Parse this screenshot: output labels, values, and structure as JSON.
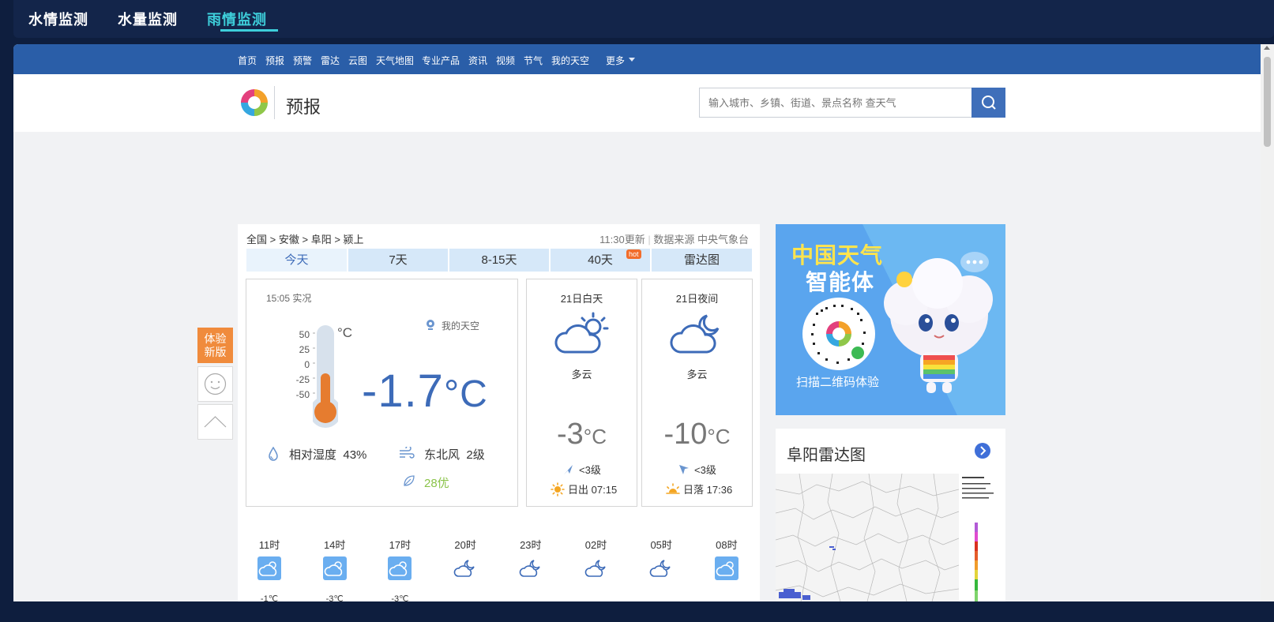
{
  "top_tabs": [
    "水情监测",
    "水量监测",
    "雨情监测"
  ],
  "nav": {
    "items": [
      "首页",
      "预报",
      "预警",
      "雷达",
      "云图",
      "天气地图",
      "专业产品",
      "资讯",
      "视频",
      "节气",
      "我的天空"
    ],
    "more": "更多"
  },
  "header": {
    "title": "预报",
    "search_placeholder": "输入城市、乡镇、街道、景点名称 查天气"
  },
  "breadcrumb": [
    "全国",
    "安徽",
    "阜阳",
    "颍上"
  ],
  "update": {
    "time": "11:30更新",
    "source": "数据来源 中央气象台"
  },
  "forecast_tabs": [
    "今天",
    "7天",
    "8-15天",
    "40天",
    "雷达图"
  ],
  "hot_badge": "hot",
  "now": {
    "time": "15:05 实况",
    "my_sky": "我的天空",
    "scale": [
      "50",
      "25",
      "0",
      "-25",
      "-50"
    ],
    "unit": "°C",
    "temp": "-1.7",
    "temp_unit": "°C",
    "thermometer_level": 0.48,
    "humidity_label": "相对湿度",
    "humidity": "43%",
    "wind_dir": "东北风",
    "wind_level": "2级",
    "aqi": "28优"
  },
  "day": {
    "title": "21日白天",
    "weather": "多云",
    "temp": "-3",
    "unit": "°C",
    "wind": "<3级",
    "sun_label": "日出",
    "sun_time": "07:15"
  },
  "night": {
    "title": "21日夜间",
    "weather": "多云",
    "temp": "-10",
    "unit": "°C",
    "wind": "<3级",
    "sun_label": "日落",
    "sun_time": "17:36"
  },
  "hourly": [
    {
      "time": "11时",
      "icon": "cloudy-day-icon",
      "temp": "-1℃"
    },
    {
      "time": "14时",
      "icon": "cloudy-day-icon",
      "temp": "-3℃"
    },
    {
      "time": "17时",
      "icon": "cloudy-day-icon",
      "temp": "-3℃"
    },
    {
      "time": "20时",
      "icon": "cloudy-night-icon",
      "temp": ""
    },
    {
      "time": "23时",
      "icon": "cloudy-night-icon",
      "temp": ""
    },
    {
      "time": "02时",
      "icon": "cloudy-night-icon",
      "temp": ""
    },
    {
      "time": "05时",
      "icon": "cloudy-night-icon",
      "temp": ""
    },
    {
      "time": "08时",
      "icon": "cloudy-day-icon",
      "temp": ""
    }
  ],
  "float": {
    "new_version": [
      "体验",
      "新版"
    ]
  },
  "ad": {
    "title": "中国天气",
    "subtitle": "智能体",
    "cta": "扫描二维码体验"
  },
  "radar": {
    "title": "阜阳雷达图"
  },
  "colors": {
    "nav_blue": "#2a5ea8",
    "accent_blue": "#3d6bb8",
    "active_tab": "#3ecfdb",
    "thermo_fill": "#e67c2f",
    "aqi_green": "#8bc34a",
    "new_version_orange": "#f08b3c"
  }
}
